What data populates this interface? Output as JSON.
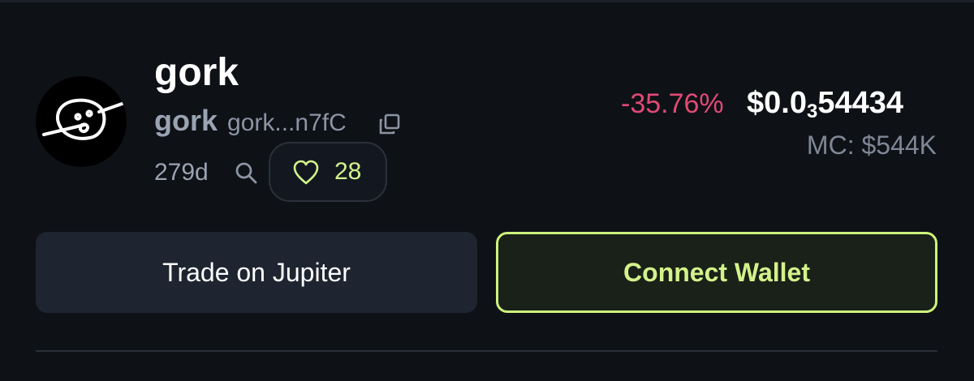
{
  "token": {
    "name": "gork",
    "ticker": "gork",
    "address": "gork...n7fC",
    "age": "279d",
    "likes": "28"
  },
  "price": {
    "change": "-35.76%",
    "prefix": "$0.0",
    "zeros_subscript": "3",
    "digits": "54434",
    "market_cap": "MC: $544K"
  },
  "actions": {
    "trade_label": "Trade on Jupiter",
    "connect_label": "Connect Wallet"
  },
  "colors": {
    "background": "#0e1116",
    "negative": "#e04a75",
    "accent": "#cdf27c"
  },
  "icons": [
    "copy-icon",
    "search-icon",
    "heart-icon"
  ]
}
